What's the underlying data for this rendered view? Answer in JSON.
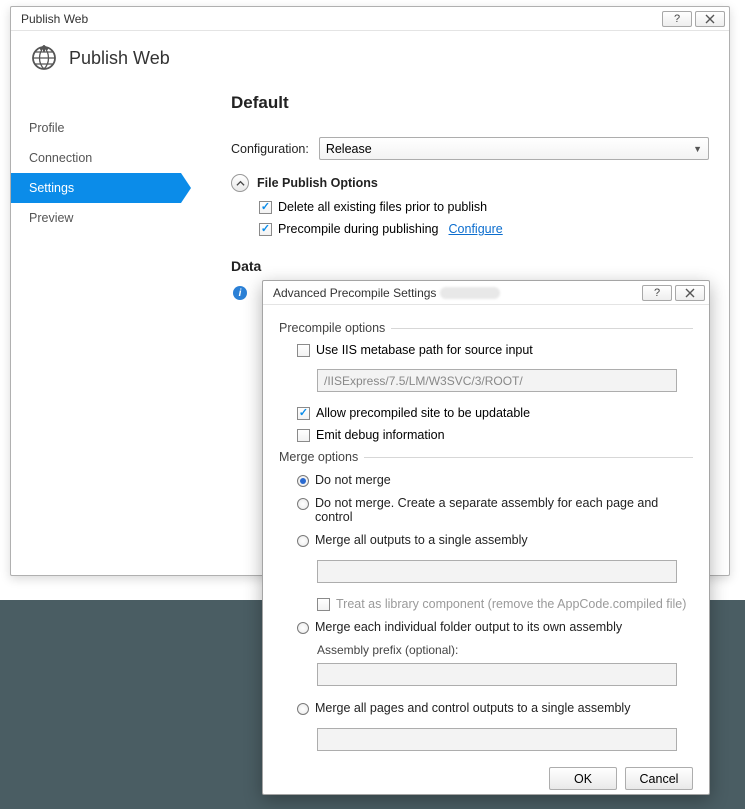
{
  "window": {
    "title": "Publish Web",
    "header_title": "Publish Web"
  },
  "sidebar": {
    "items": [
      {
        "label": "Profile"
      },
      {
        "label": "Connection"
      },
      {
        "label": "Settings"
      },
      {
        "label": "Preview"
      }
    ]
  },
  "main": {
    "profile_name": "Default",
    "config_label": "Configuration:",
    "config_value": "Release",
    "file_publish_title": "File Publish Options",
    "delete_label": "Delete all existing files prior to publish",
    "precompile_label": "Precompile during publishing",
    "configure_link": "Configure",
    "databases_label": "Data"
  },
  "dialog": {
    "title": "Advanced Precompile Settings",
    "precompile_legend": "Precompile options",
    "use_iis_label": "Use IIS metabase path for source input",
    "iis_path_value": "/IISExpress/7.5/LM/W3SVC/3/ROOT/",
    "allow_updatable_label": "Allow precompiled site to be updatable",
    "emit_debug_label": "Emit debug information",
    "merge_legend": "Merge options",
    "merge_opts": [
      "Do not merge",
      "Do not merge. Create a separate assembly for each page and control",
      "Merge all outputs to a single assembly",
      "Merge each individual folder output to its own assembly",
      "Merge all pages and control outputs to a single assembly"
    ],
    "treat_library_label": "Treat as library component (remove the AppCode.compiled file)",
    "assembly_prefix_label": "Assembly prefix (optional):",
    "ok": "OK",
    "cancel": "Cancel"
  }
}
